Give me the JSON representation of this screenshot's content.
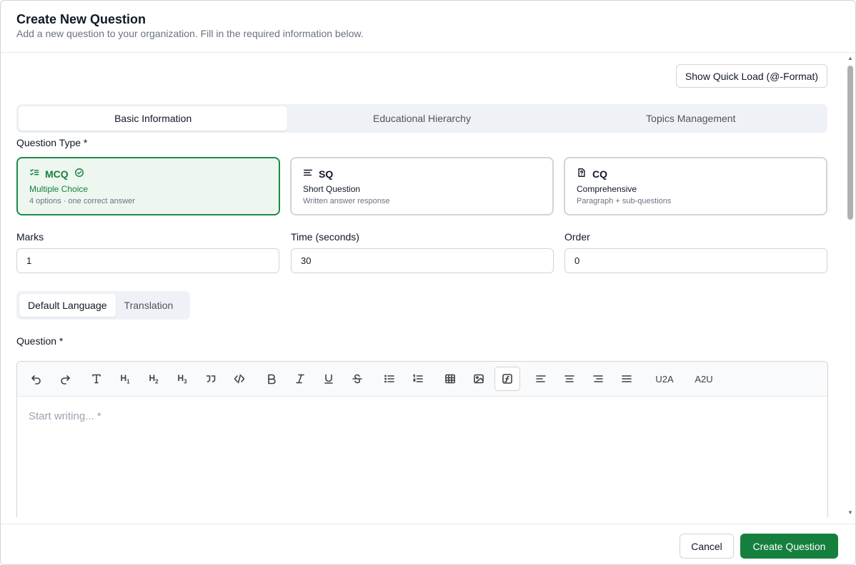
{
  "dialog": {
    "title": "Create New Question",
    "subtitle": "Add a new question to your organization. Fill in the required information below."
  },
  "quick_load_label": "Show Quick Load (@-Format)",
  "tabs": [
    {
      "label": "Basic Information",
      "active": true
    },
    {
      "label": "Educational Hierarchy",
      "active": false
    },
    {
      "label": "Topics Management",
      "active": false
    }
  ],
  "question_type": {
    "label": "Question Type *",
    "options": [
      {
        "code": "MCQ",
        "name": "Multiple Choice",
        "desc": "4 options · one correct answer",
        "icon": "list-checks-icon",
        "selected": true
      },
      {
        "code": "SQ",
        "name": "Short Question",
        "desc": "Written answer response",
        "icon": "align-left-icon",
        "selected": false
      },
      {
        "code": "CQ",
        "name": "Comprehensive",
        "desc": "Paragraph + sub-questions",
        "icon": "file-question-icon",
        "selected": false
      }
    ]
  },
  "fields": {
    "marks": {
      "label": "Marks",
      "value": "1"
    },
    "time": {
      "label": "Time (seconds)",
      "value": "30"
    },
    "order": {
      "label": "Order",
      "value": "0"
    }
  },
  "language_tabs": [
    {
      "label": "Default Language",
      "active": true
    },
    {
      "label": "Translation",
      "active": false
    }
  ],
  "question": {
    "label": "Question *",
    "placeholder": "Start writing... *",
    "toolbar": {
      "u2a": "U2A",
      "a2u": "A2U",
      "icons": [
        "undo-icon",
        "redo-icon",
        "text-icon",
        "heading-1-icon",
        "heading-2-icon",
        "heading-3-icon",
        "quote-icon",
        "code-icon",
        "bold-icon",
        "italic-icon",
        "underline-icon",
        "strikethrough-icon",
        "bullet-list-icon",
        "ordered-list-icon",
        "table-icon",
        "image-icon",
        "formula-icon",
        "align-left-icon",
        "align-center-icon",
        "align-right-icon",
        "align-justify-icon"
      ],
      "active_tool": "formula-icon"
    }
  },
  "footer": {
    "cancel_label": "Cancel",
    "create_label": "Create Question"
  },
  "colors": {
    "primary": "#15803d",
    "selected_bg": "#edf7f0",
    "tab_bg": "#eef2f6"
  }
}
